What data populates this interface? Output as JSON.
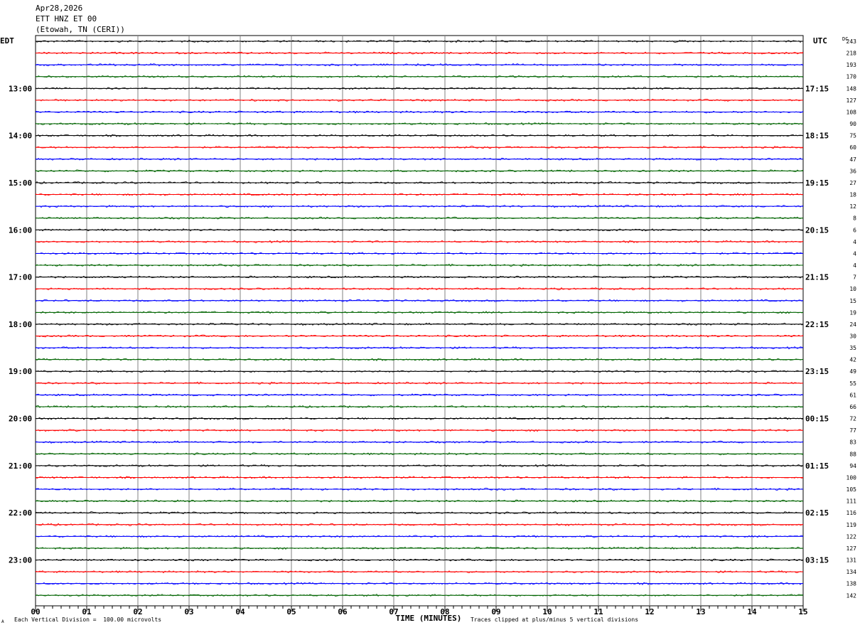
{
  "header": {
    "date": "Apr28,2026",
    "station": "ETT HNZ ET 00",
    "location": "(Etowah, TN (CERI))"
  },
  "left_tz_label": "EDT",
  "right_tz_label": "UTC",
  "dc_header": "DC",
  "footer": {
    "scale_note": "Each Vertical Division =  100.00 microvolts",
    "clip_note": "Traces clipped at plus/minus 5 vertical divisions",
    "corner_mark": "A"
  },
  "colors": {
    "black": "#000000",
    "red": "#ff0000",
    "blue": "#0000ff",
    "green": "#006400",
    "grid": "#808080"
  },
  "chart_data": {
    "type": "line",
    "title": "ETT HNZ ET 00",
    "xlabel": "TIME (MINUTES)",
    "ylabel": "",
    "x_ticks": [
      "00",
      "01",
      "02",
      "03",
      "04",
      "05",
      "06",
      "07",
      "08",
      "09",
      "10",
      "11",
      "12",
      "13",
      "14",
      "15"
    ],
    "xlim": [
      0,
      15
    ],
    "trace_count": 48,
    "trace_colors": [
      "black",
      "red",
      "blue",
      "green"
    ],
    "left_hour_labels": [
      "13:00",
      "14:00",
      "15:00",
      "16:00",
      "17:00",
      "18:00",
      "19:00",
      "20:00",
      "21:00",
      "22:00",
      "23:00"
    ],
    "right_hour_labels": [
      "17:15",
      "18:15",
      "19:15",
      "20:15",
      "21:15",
      "22:15",
      "23:15",
      "00:15",
      "01:15",
      "02:15",
      "03:15"
    ],
    "dc_offsets": [
      "243",
      "218",
      "193",
      "170",
      "148",
      "127",
      "108",
      "90",
      "75",
      "60",
      "47",
      "36",
      "27",
      "18",
      "12",
      "8",
      "6",
      "4",
      "4",
      "4",
      "7",
      "10",
      "15",
      "19",
      "24",
      "30",
      "35",
      "42",
      "49",
      "55",
      "61",
      "66",
      "72",
      "77",
      "83",
      "88",
      "94",
      "100",
      "105",
      "111",
      "116",
      "119",
      "122",
      "127",
      "131",
      "134",
      "138",
      "142"
    ]
  }
}
